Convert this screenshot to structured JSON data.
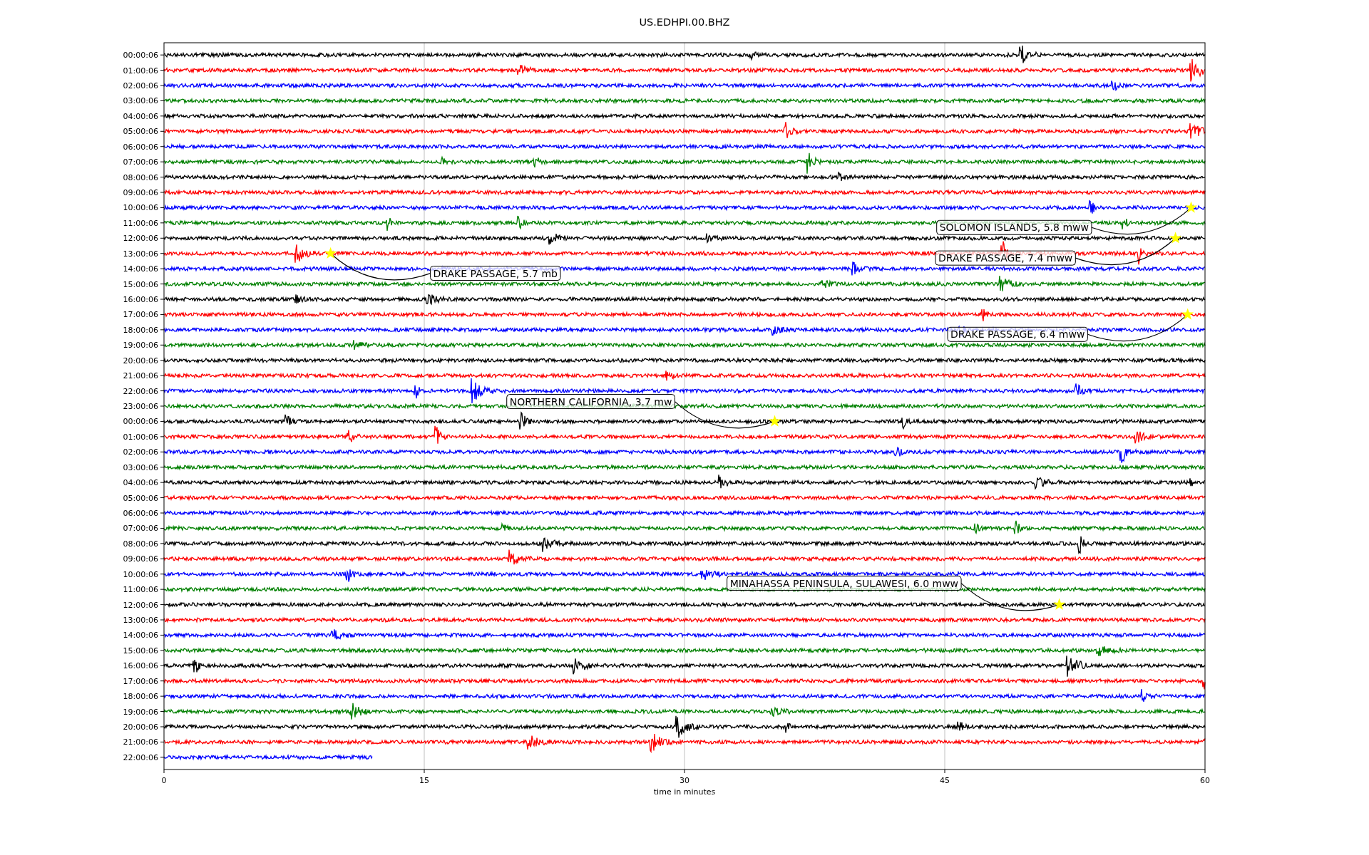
{
  "title": "US.EDHPI.00.BHZ",
  "traces": [
    {
      "label": "00:00:06",
      "color": "#000000",
      "level": 1
    },
    {
      "label": "01:00:06",
      "color": "#ff0000",
      "level": 1
    },
    {
      "label": "02:00:06",
      "color": "#0000ff",
      "level": 1
    },
    {
      "label": "03:00:06",
      "color": "#008000",
      "level": 1
    },
    {
      "label": "04:00:06",
      "color": "#000000",
      "level": 1
    },
    {
      "label": "05:00:06",
      "color": "#ff0000",
      "level": 1
    },
    {
      "label": "06:00:06",
      "color": "#0000ff",
      "level": 1
    },
    {
      "label": "07:00:06",
      "color": "#008000",
      "level": 1
    },
    {
      "label": "08:00:06",
      "color": "#000000",
      "level": 1
    },
    {
      "label": "09:00:06",
      "color": "#ff0000",
      "level": 1
    },
    {
      "label": "10:00:06",
      "color": "#0000ff",
      "level": 1
    },
    {
      "label": "11:00:06",
      "color": "#008000",
      "level": 1
    },
    {
      "label": "12:00:06",
      "color": "#000000",
      "level": 1
    },
    {
      "label": "13:00:06",
      "color": "#ff0000",
      "level": 1
    },
    {
      "label": "14:00:06",
      "color": "#0000ff",
      "level": 1
    },
    {
      "label": "15:00:06",
      "color": "#008000",
      "level": 1
    },
    {
      "label": "16:00:06",
      "color": "#000000",
      "level": 1
    },
    {
      "label": "17:00:06",
      "color": "#ff0000",
      "level": 1
    },
    {
      "label": "18:00:06",
      "color": "#0000ff",
      "level": 1
    },
    {
      "label": "19:00:06",
      "color": "#008000",
      "level": 1
    },
    {
      "label": "20:00:06",
      "color": "#000000",
      "level": 1
    },
    {
      "label": "21:00:06",
      "color": "#ff0000",
      "level": 1
    },
    {
      "label": "22:00:06",
      "color": "#0000ff",
      "level": 1
    },
    {
      "label": "23:00:06",
      "color": "#008000",
      "level": 1
    },
    {
      "label": "00:00:06",
      "color": "#000000",
      "level": 1
    },
    {
      "label": "01:00:06",
      "color": "#ff0000",
      "level": 1
    },
    {
      "label": "02:00:06",
      "color": "#0000ff",
      "level": 1
    },
    {
      "label": "03:00:06",
      "color": "#008000",
      "level": 1
    },
    {
      "label": "04:00:06",
      "color": "#000000",
      "level": 1
    },
    {
      "label": "05:00:06",
      "color": "#ff0000",
      "level": 1
    },
    {
      "label": "06:00:06",
      "color": "#0000ff",
      "level": 1
    },
    {
      "label": "07:00:06",
      "color": "#008000",
      "level": 1
    },
    {
      "label": "08:00:06",
      "color": "#000000",
      "level": 1
    },
    {
      "label": "09:00:06",
      "color": "#ff0000",
      "level": 1
    },
    {
      "label": "10:00:06",
      "color": "#0000ff",
      "level": 1
    },
    {
      "label": "11:00:06",
      "color": "#008000",
      "level": 1
    },
    {
      "label": "12:00:06",
      "color": "#000000",
      "level": 1
    },
    {
      "label": "13:00:06",
      "color": "#ff0000",
      "level": 1
    },
    {
      "label": "14:00:06",
      "color": "#0000ff",
      "level": 1
    },
    {
      "label": "15:00:06",
      "color": "#008000",
      "level": 1
    },
    {
      "label": "16:00:06",
      "color": "#000000",
      "level": 1
    },
    {
      "label": "17:00:06",
      "color": "#ff0000",
      "level": 1
    },
    {
      "label": "18:00:06",
      "color": "#0000ff",
      "level": 1
    },
    {
      "label": "19:00:06",
      "color": "#008000",
      "level": 1
    },
    {
      "label": "20:00:06",
      "color": "#000000",
      "level": 1
    },
    {
      "label": "21:00:06",
      "color": "#ff0000",
      "level": 1
    },
    {
      "label": "22:00:06",
      "color": "#0000ff",
      "level": 0.2
    }
  ],
  "x_axis": {
    "ticks": [
      "0",
      "15",
      "30",
      "45",
      "60"
    ],
    "label": "time in minutes"
  },
  "events": [
    {
      "text": "SOLOMON ISLANDS, 5.8 mww"
    },
    {
      "text": "DRAKE PASSAGE, 7.4 mww"
    },
    {
      "text": "DRAKE PASSAGE, 5.7 mb"
    },
    {
      "text": "DRAKE PASSAGE, 6.4 mww"
    },
    {
      "text": "NORTHERN CALIFORNIA, 3.7 mw"
    },
    {
      "text": "MINAHASSA PENINSULA, SULAWESI, 6.0 mww"
    }
  ]
}
